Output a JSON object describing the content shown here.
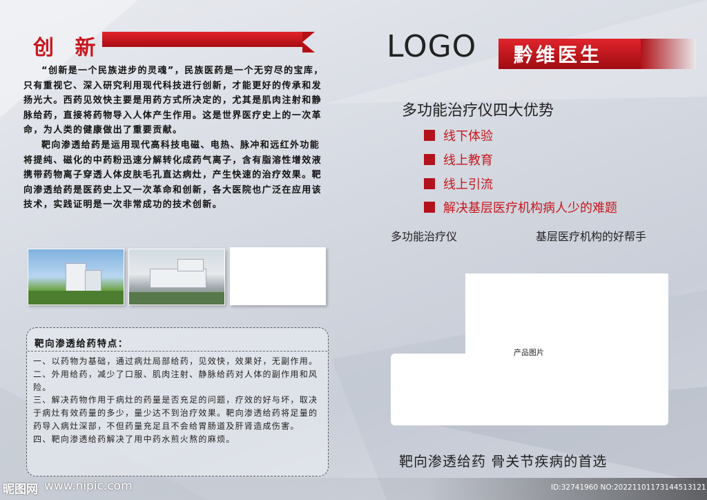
{
  "left": {
    "title": "创 新",
    "intro_paragraphs": [
      "“创新是一个民族进步的灵魂”，民族医药是一个无穷尽的宝库，只有重视它、深入研究利用现代科技进行创新，才能更好的传承和发扬光大。西药见效快主要是用药方式所决定的，尤其是肌肉注射和静脉给药，直接将药物导入人体产生作用。这是世界医疗史上的一次革命，为人类的健康做出了重要贡献。",
      "靶向渗透给药是运用现代高科技电磁、电热、脉冲和远红外功能将提纯、磁化的中药粉迅速分解转化成药气离子，含有脂溶性增效液携带药物离子穿透人体皮肤毛孔直达病灶，产生快速的治疗效果。靶向渗透给药是医药史上又一次革命和创新，各大医院也广泛在应用该技术，实践证明是一次非常成功的技术创新。"
    ],
    "features_title": "靶向渗透给药特点：",
    "features": [
      "一、以药物为基础，通过病灶局部给药，见效快，效果好，无副作用。",
      "二、外用给药，减少了口服、肌肉注射、静脉给药对人体的副作用和风险。",
      "三、解决药物作用于病灶的药量是否充足的问题，疗效的好与坏，取决于病灶有效药量的多少，量少达不到治疗效果。靶向渗透给药将足量的药导入病灶深部，不但药量充足且不会给胃肠道及肝肾造成伤害。",
      "四、靶向渗透给药解决了用中药水煎火熬的麻烦。"
    ]
  },
  "right": {
    "logo": "LOGO",
    "brand": "黔维医生",
    "headline": "多功能治疗仪四大优势",
    "advantages": [
      "线下体验",
      "线上教育",
      "线上引流",
      "解决基层医疗机构病人少的难题"
    ],
    "sub_left": "多功能治疗仪",
    "sub_right": "基层医疗机构的好帮手",
    "product_label": "产品图片",
    "slogan": "靶向渗透给药  骨关节疾病的首选"
  },
  "watermark": {
    "site_name": "昵图网",
    "url": "www.nipic.com",
    "id_text": "ID:32741960 NO:20221101173144513121"
  },
  "colors": {
    "accent_red": "#c8161d",
    "ribbon_dark": "#a80d13"
  }
}
